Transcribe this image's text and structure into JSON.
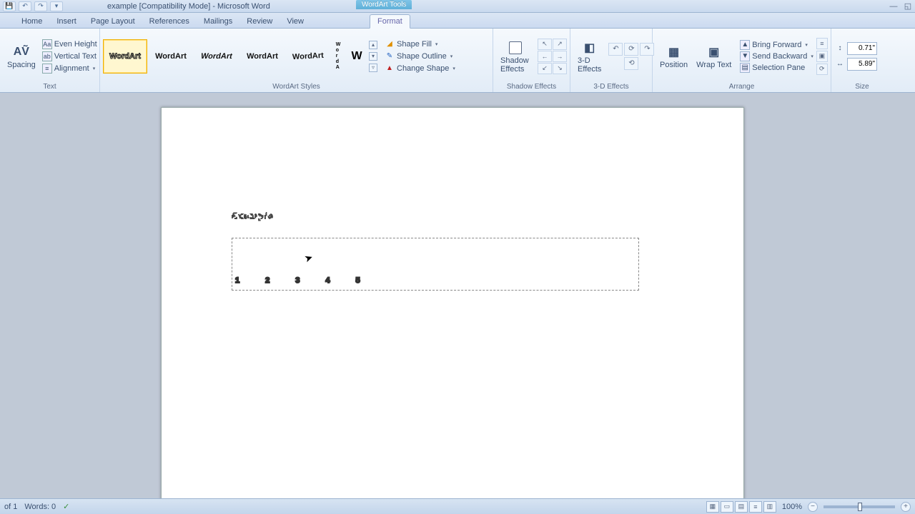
{
  "titlebar": {
    "title": "example [Compatibility Mode] - Microsoft Word",
    "contextual_label": "WordArt Tools"
  },
  "tabs": {
    "home": "Home",
    "insert": "Insert",
    "page_layout": "Page Layout",
    "references": "References",
    "mailings": "Mailings",
    "review": "Review",
    "view": "View",
    "format": "Format"
  },
  "ribbon": {
    "text_group": {
      "label": "Text",
      "spacing": "Spacing",
      "even_height": "Even Height",
      "vertical_text": "Vertical Text",
      "alignment": "Alignment"
    },
    "wordart_styles_group": {
      "label": "WordArt Styles",
      "thumb_label": "WordArt",
      "shape_fill": "Shape Fill",
      "shape_outline": "Shape Outline",
      "change_shape": "Change Shape"
    },
    "shadow_group": {
      "label": "Shadow Effects",
      "button": "Shadow Effects"
    },
    "threed_group": {
      "label": "3-D Effects",
      "button": "3-D Effects"
    },
    "arrange_group": {
      "label": "Arrange",
      "position": "Position",
      "wrap_text": "Wrap Text",
      "bring_forward": "Bring Forward",
      "send_backward": "Send Backward",
      "selection_pane": "Selection Pane"
    },
    "size_group": {
      "label": "Size",
      "height": "0.71\"",
      "width": "5.89\""
    }
  },
  "document": {
    "wordart_example": "Example",
    "wordart_numbers": "12345"
  },
  "statusbar": {
    "page": "of 1",
    "words": "Words: 0",
    "zoom": "100%"
  },
  "chart_data": null
}
